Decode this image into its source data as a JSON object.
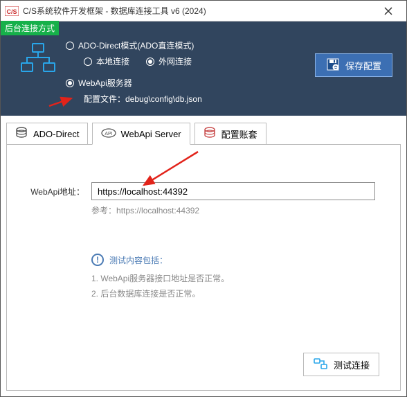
{
  "window": {
    "title": "C/S系统软件开发框架 - 数据库连接工具 v6 (2024)"
  },
  "top": {
    "badge": "后台连接方式",
    "radio_ado": "ADO-Direct模式(ADO直连模式)",
    "radio_local": "本地连接",
    "radio_remote": "外网连接",
    "radio_webapi": "WebApi服务器",
    "config_label": "配置文件：",
    "config_path": "debug\\config\\db.json",
    "save_btn": "保存配置"
  },
  "tabs": {
    "ado": "ADO-Direct",
    "webapi": "WebApi Server",
    "account": "配置账套"
  },
  "form": {
    "url_label": "WebApi地址：",
    "url_value": "https://localhost:44392",
    "hint_prefix": "参考：",
    "hint_url": "https://localhost:44392"
  },
  "info": {
    "heading": "测试内容包括：",
    "item1": "1. WebApi服务器接口地址是否正常。",
    "item2": "2. 后台数据库连接是否正常。"
  },
  "footer": {
    "test_btn": "测试连接"
  }
}
